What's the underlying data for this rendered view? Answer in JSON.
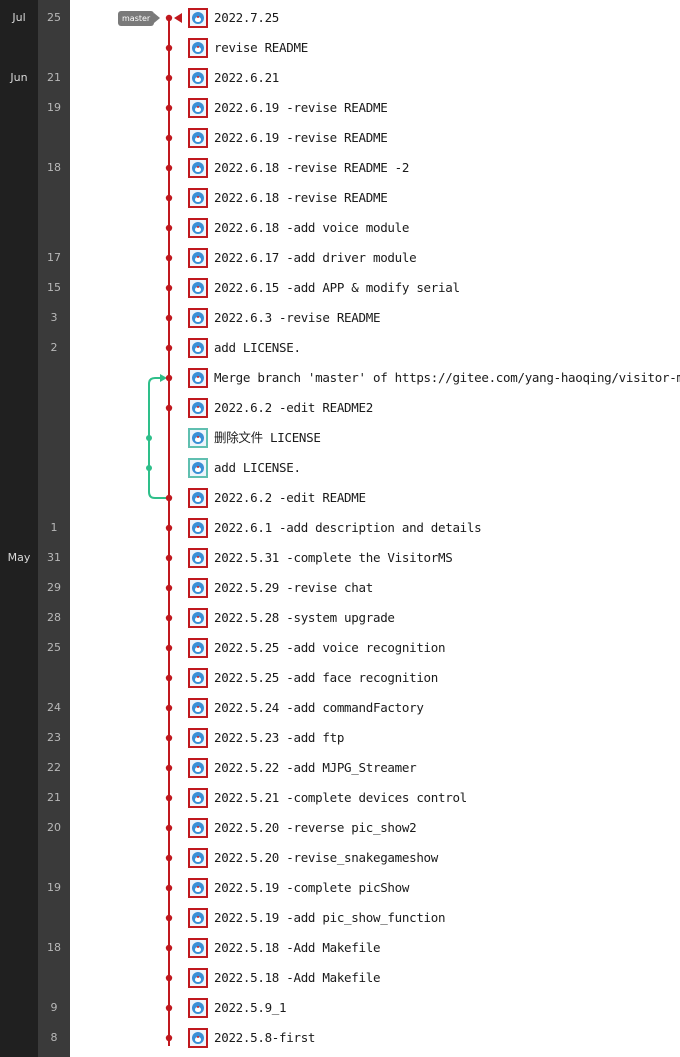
{
  "branch_tag": "master",
  "colors": {
    "main_line": "#c0181e",
    "merge_line": "#2ebf8a",
    "month_bg": "#202020",
    "day_bg": "#3a3a3a"
  },
  "months": [
    {
      "label": "Jul",
      "row": 0
    },
    {
      "label": "Jun",
      "row": 2
    },
    {
      "label": "May",
      "row": 18
    }
  ],
  "commits": [
    {
      "day": "25",
      "message": "2022.7.25",
      "avatar": "avatar-icon"
    },
    {
      "day": "",
      "message": "revise README",
      "avatar": "avatar-icon"
    },
    {
      "day": "21",
      "message": "2022.6.21",
      "avatar": "avatar-icon"
    },
    {
      "day": "19",
      "message": "2022.6.19 -revise README",
      "avatar": "avatar-icon"
    },
    {
      "day": "",
      "message": "2022.6.19 -revise README",
      "avatar": "avatar-icon"
    },
    {
      "day": "18",
      "message": "2022.6.18 -revise README -2",
      "avatar": "avatar-icon"
    },
    {
      "day": "",
      "message": "2022.6.18 -revise README",
      "avatar": "avatar-icon"
    },
    {
      "day": "",
      "message": "2022.6.18 -add voice module",
      "avatar": "avatar-icon"
    },
    {
      "day": "17",
      "message": "2022.6.17 -add driver module",
      "avatar": "avatar-icon"
    },
    {
      "day": "15",
      "message": "2022.6.15 -add APP & modify serial",
      "avatar": "avatar-icon"
    },
    {
      "day": "3",
      "message": "2022.6.3 -revise README",
      "avatar": "avatar-icon"
    },
    {
      "day": "2",
      "message": "add LICENSE.",
      "avatar": "avatar-icon"
    },
    {
      "day": "",
      "message": "Merge branch 'master' of https://gitee.com/yang-haoqing/visitor-ms",
      "avatar": "avatar-icon"
    },
    {
      "day": "",
      "message": "2022.6.2 -edit README2",
      "avatar": "avatar-icon"
    },
    {
      "day": "",
      "message": "删除文件 LICENSE",
      "avatar": "avatar-icon-alt"
    },
    {
      "day": "",
      "message": "add LICENSE.",
      "avatar": "avatar-icon-alt"
    },
    {
      "day": "",
      "message": "2022.6.2 -edit README",
      "avatar": "avatar-icon"
    },
    {
      "day": "1",
      "message": "2022.6.1 -add description and details",
      "avatar": "avatar-icon"
    },
    {
      "day": "31",
      "message": "2022.5.31 -complete the VisitorMS",
      "avatar": "avatar-icon"
    },
    {
      "day": "29",
      "message": "2022.5.29 -revise chat",
      "avatar": "avatar-icon"
    },
    {
      "day": "28",
      "message": "2022.5.28 -system upgrade",
      "avatar": "avatar-icon"
    },
    {
      "day": "25",
      "message": "2022.5.25 -add voice recognition",
      "avatar": "avatar-icon"
    },
    {
      "day": "",
      "message": "2022.5.25 -add face recognition",
      "avatar": "avatar-icon"
    },
    {
      "day": "24",
      "message": "2022.5.24 -add commandFactory",
      "avatar": "avatar-icon"
    },
    {
      "day": "23",
      "message": "2022.5.23 -add ftp",
      "avatar": "avatar-icon"
    },
    {
      "day": "22",
      "message": "2022.5.22 -add MJPG_Streamer",
      "avatar": "avatar-icon"
    },
    {
      "day": "21",
      "message": "2022.5.21 -complete devices control",
      "avatar": "avatar-icon"
    },
    {
      "day": "20",
      "message": "2022.5.20 -reverse pic_show2",
      "avatar": "avatar-icon"
    },
    {
      "day": "",
      "message": "2022.5.20 -revise_snakegameshow",
      "avatar": "avatar-icon"
    },
    {
      "day": "19",
      "message": "2022.5.19 -complete picShow",
      "avatar": "avatar-icon"
    },
    {
      "day": "",
      "message": "2022.5.19 -add pic_show_function",
      "avatar": "avatar-icon"
    },
    {
      "day": "18",
      "message": "2022.5.18 -Add Makefile",
      "avatar": "avatar-icon"
    },
    {
      "day": "",
      "message": "2022.5.18 -Add Makefile",
      "avatar": "avatar-icon"
    },
    {
      "day": "9",
      "message": "2022.5.9_1",
      "avatar": "avatar-icon"
    },
    {
      "day": "8",
      "message": "2022.5.8-first",
      "avatar": "avatar-icon"
    }
  ],
  "merge": {
    "merge_row": 12,
    "branch_start_row": 16,
    "branch_commit_rows": [
      14,
      15
    ]
  }
}
